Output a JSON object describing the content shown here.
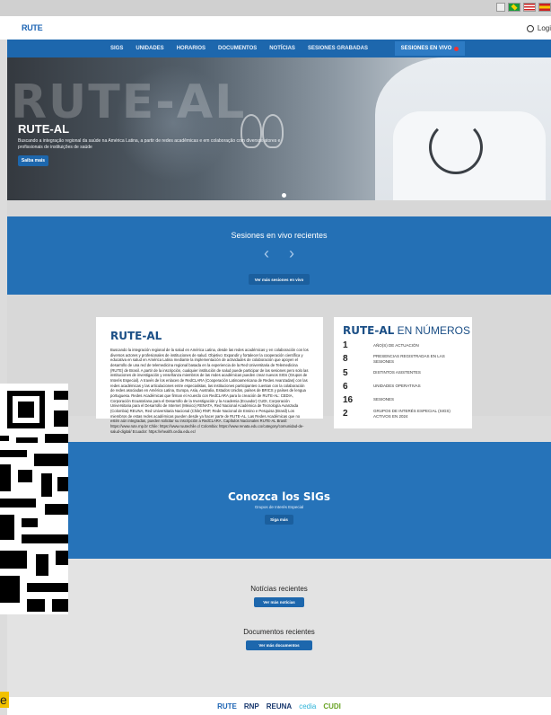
{
  "topbar": {
    "flags": [
      "flag-brazil",
      "flag-usa",
      "flag-spain"
    ]
  },
  "header": {
    "logo": "RUTE",
    "login_label": "Logi"
  },
  "nav": {
    "items": [
      "SIGS",
      "UNIDADES",
      "HORARIOS",
      "DOCUMENTOS",
      "NOTÍCIAS",
      "SESIONES GRABADAS"
    ],
    "live_label": "SESIONES EN VIVO"
  },
  "hero": {
    "bigword": "RUTE-AL",
    "title": "RUTE-AL",
    "description": "Buscando a integração regional da saúde na América Latina, a partir de redes acadêmicas e em colaboração com diversos atores e profissionais de instituições de saúde",
    "button": "Saiba mais"
  },
  "live_sessions": {
    "title": "Sesiones en vivo recientes",
    "prev": "‹",
    "next": "›",
    "button": "Ver más sesiones en vivo"
  },
  "about": {
    "title": "RUTE-AL",
    "text": "Buscando la integración regional de la salud en América Latina, desde las redes académicas y en colaboración con los diversos actores y profesionales de instituciones de salud. Objetivo: Expandir y fortalecer la cooperación científica y educativa en salud en América Latina mediante la implementación de actividades de colaboración que apoyen el desarrollo de una red de telemedicina regional basada en la experiencia de la Red Universitaria de Telemedicina (RUTE) de Brasil. A partir de la inscripción, cualquier institución de salud puede participar de las sesiones pero solo las instituciones de investigación y enseñanza miembros de las redes académicas pueden crear nuevos SIGs (Grupos de Interés Especial). A través de los enlaces de RedCLARA (Cooperación Latinoamericana de Redes Avanzadas) con las redes académicas y las articulaciones entre especialistas, las instituciones participantes cuentan con la colaboración de redes asociadas en América Latina, Europa, Asia, Australia, Estados Unidos, países de BRICS y países de lengua portuguesa. Redes Académicas que firman el Acuerdo con RedCLARA para la creación de RUTE-AL: CEDIA, Corporación Ecuatoriana para el Desarrollo de la Investigación y la Academia (Ecuador) CUDI, Corporación Universitaria para el Desarrollo de Internet (México) RENATA, Red Nacional Académica de Tecnología Avanzada (Colombia) REUNA, Red Universitaria Nacional (Chile) RNP, Rede Nacional de Ensino e Pesquisa (Brasil) Los miembros de estas redes académicas pueden desde ya hacer parte de RUTE-AL. Las Redes Académicas que no estén aún integradas, pueden solicitar su inscripción a RedCLARA. Capítulos Nacionales RUTE-AL Brasil: https://www.rute.rnp.br Chile: https://www.ruutechile.cl Colombia: https://www.renata.edu.co/category/comunidad-de-salud-digital/ Ecuador: https://ehealth.cedia.edu.ec/"
  },
  "numbers": {
    "title_bold": "RUTE-AL",
    "title_rest": " EN NÚMEROS",
    "rows": [
      {
        "value": "1",
        "label": "AÑO(S) DE ACTUACIÓN"
      },
      {
        "value": "8",
        "label": "PRESENCIAS REGISTRADAS EN LAS SESIONES"
      },
      {
        "value": "5",
        "label": "DISTINTOS ASISTENTES"
      },
      {
        "value": "6",
        "label": "UNIDADES OPERATIVAS"
      },
      {
        "value": "16",
        "label": "SESIONES"
      },
      {
        "value": "2",
        "label": "GRUPOS DE INTERÉS ESPECIAL (SIGS) ACTIVOS EN 2024"
      }
    ]
  },
  "sigs": {
    "title": "Conozca los SIGs",
    "subtitle": "Grupos de Interés Especial",
    "button": "Siga más"
  },
  "news": {
    "title": "Notícias recientes",
    "button": "Ver más notícias"
  },
  "documents": {
    "title": "Documentos recientes",
    "button": "Ver más documentos"
  },
  "footer": {
    "partners": [
      "RUTE",
      "RNP",
      "REUNA",
      "cedia",
      "CUDI"
    ]
  },
  "edge_letter": "e"
}
